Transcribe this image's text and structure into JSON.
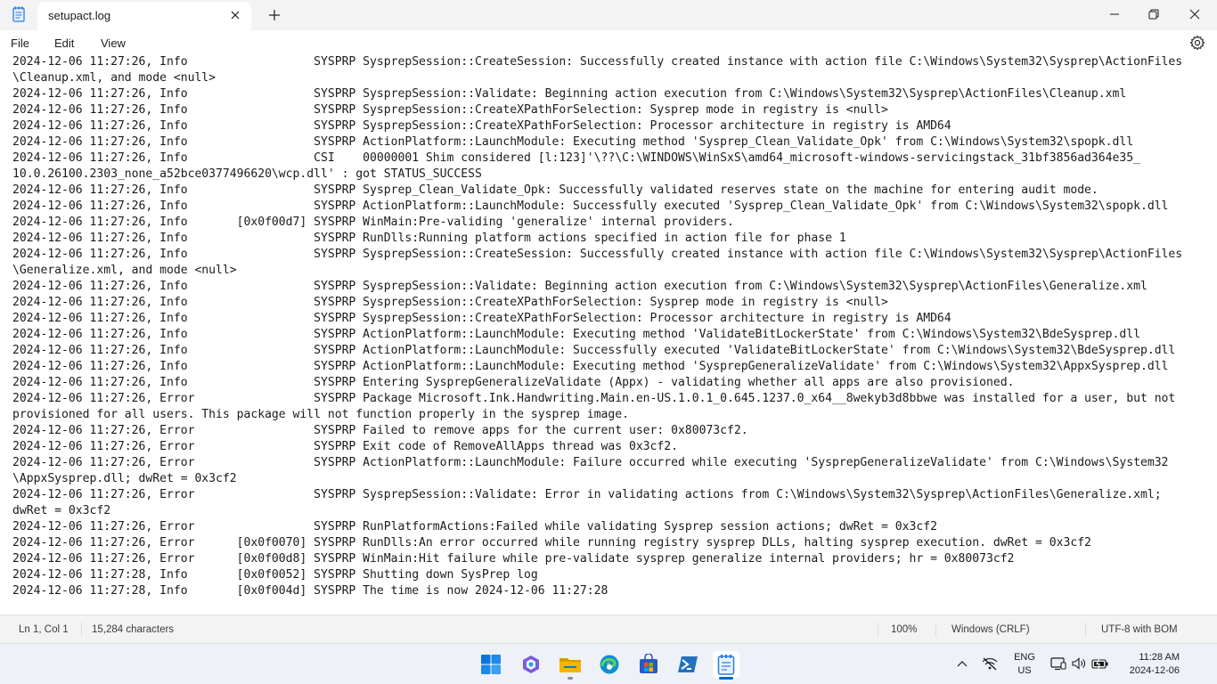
{
  "window": {
    "tab_title": "setupact.log",
    "new_tab_symbol": "+",
    "controls": [
      "minimize-icon",
      "maximize-icon",
      "close-icon"
    ]
  },
  "menu": {
    "file": "File",
    "edit": "Edit",
    "view": "View",
    "settings_icon": "gear-icon"
  },
  "editor": {
    "content": "2024-12-06 11:27:26, Info                  SYSPRP SysprepSession::CreateSession: Successfully created instance with action file C:\\Windows\\System32\\Sysprep\\ActionFiles\n\\Cleanup.xml, and mode <null>\n2024-12-06 11:27:26, Info                  SYSPRP SysprepSession::Validate: Beginning action execution from C:\\Windows\\System32\\Sysprep\\ActionFiles\\Cleanup.xml\n2024-12-06 11:27:26, Info                  SYSPRP SysprepSession::CreateXPathForSelection: Sysprep mode in registry is <null>\n2024-12-06 11:27:26, Info                  SYSPRP SysprepSession::CreateXPathForSelection: Processor architecture in registry is AMD64\n2024-12-06 11:27:26, Info                  SYSPRP ActionPlatform::LaunchModule: Executing method 'Sysprep_Clean_Validate_Opk' from C:\\Windows\\System32\\spopk.dll\n2024-12-06 11:27:26, Info                  CSI    00000001 Shim considered [l:123]'\\??\\C:\\WINDOWS\\WinSxS\\amd64_microsoft-windows-servicingstack_31bf3856ad364e35_\n10.0.26100.2303_none_a52bce0377496620\\wcp.dll' : got STATUS_SUCCESS\n2024-12-06 11:27:26, Info                  SYSPRP Sysprep_Clean_Validate_Opk: Successfully validated reserves state on the machine for entering audit mode.\n2024-12-06 11:27:26, Info                  SYSPRP ActionPlatform::LaunchModule: Successfully executed 'Sysprep_Clean_Validate_Opk' from C:\\Windows\\System32\\spopk.dll\n2024-12-06 11:27:26, Info       [0x0f00d7] SYSPRP WinMain:Pre-validing 'generalize' internal providers.\n2024-12-06 11:27:26, Info                  SYSPRP RunDlls:Running platform actions specified in action file for phase 1\n2024-12-06 11:27:26, Info                  SYSPRP SysprepSession::CreateSession: Successfully created instance with action file C:\\Windows\\System32\\Sysprep\\ActionFiles\n\\Generalize.xml, and mode <null>\n2024-12-06 11:27:26, Info                  SYSPRP SysprepSession::Validate: Beginning action execution from C:\\Windows\\System32\\Sysprep\\ActionFiles\\Generalize.xml\n2024-12-06 11:27:26, Info                  SYSPRP SysprepSession::CreateXPathForSelection: Sysprep mode in registry is <null>\n2024-12-06 11:27:26, Info                  SYSPRP SysprepSession::CreateXPathForSelection: Processor architecture in registry is AMD64\n2024-12-06 11:27:26, Info                  SYSPRP ActionPlatform::LaunchModule: Executing method 'ValidateBitLockerState' from C:\\Windows\\System32\\BdeSysprep.dll\n2024-12-06 11:27:26, Info                  SYSPRP ActionPlatform::LaunchModule: Successfully executed 'ValidateBitLockerState' from C:\\Windows\\System32\\BdeSysprep.dll\n2024-12-06 11:27:26, Info                  SYSPRP ActionPlatform::LaunchModule: Executing method 'SysprepGeneralizeValidate' from C:\\Windows\\System32\\AppxSysprep.dll\n2024-12-06 11:27:26, Info                  SYSPRP Entering SysprepGeneralizeValidate (Appx) - validating whether all apps are also provisioned.\n2024-12-06 11:27:26, Error                 SYSPRP Package Microsoft.Ink.Handwriting.Main.en-US.1.0.1_0.645.1237.0_x64__8wekyb3d8bbwe was installed for a user, but not\nprovisioned for all users. This package will not function properly in the sysprep image.\n2024-12-06 11:27:26, Error                 SYSPRP Failed to remove apps for the current user: 0x80073cf2.\n2024-12-06 11:27:26, Error                 SYSPRP Exit code of RemoveAllApps thread was 0x3cf2.\n2024-12-06 11:27:26, Error                 SYSPRP ActionPlatform::LaunchModule: Failure occurred while executing 'SysprepGeneralizeValidate' from C:\\Windows\\System32\n\\AppxSysprep.dll; dwRet = 0x3cf2\n2024-12-06 11:27:26, Error                 SYSPRP SysprepSession::Validate: Error in validating actions from C:\\Windows\\System32\\Sysprep\\ActionFiles\\Generalize.xml;\ndwRet = 0x3cf2\n2024-12-06 11:27:26, Error                 SYSPRP RunPlatformActions:Failed while validating Sysprep session actions; dwRet = 0x3cf2\n2024-12-06 11:27:26, Error      [0x0f0070] SYSPRP RunDlls:An error occurred while running registry sysprep DLLs, halting sysprep execution. dwRet = 0x3cf2\n2024-12-06 11:27:26, Error      [0x0f00d8] SYSPRP WinMain:Hit failure while pre-validate sysprep generalize internal providers; hr = 0x80073cf2\n2024-12-06 11:27:28, Info       [0x0f0052] SYSPRP Shutting down SysPrep log\n2024-12-06 11:27:28, Info       [0x0f004d] SYSPRP The time is now 2024-12-06 11:27:28"
  },
  "status": {
    "position": "Ln 1, Col 1",
    "characters": "15,284 characters",
    "zoom": "100%",
    "line_ending": "Windows (CRLF)",
    "encoding": "UTF-8 with BOM"
  },
  "taskbar": {
    "apps": [
      "windows-start-icon",
      "copilot-icon",
      "file-explorer-icon",
      "edge-browser-icon",
      "microsoft-store-icon",
      "powershell-icon",
      "notepad-icon"
    ],
    "active_app": "notepad-icon",
    "language_line1": "ENG",
    "language_line2": "US",
    "time": "11:28 AM",
    "date": "2024-12-06",
    "colors": {
      "start": "#0a74d9",
      "explorer": "#f4b400",
      "edge": "#0f8fd4",
      "store": "#2b59c3",
      "powershell": "#2671be",
      "notepad": "#2a7de1",
      "indicator": "#0067c0"
    }
  }
}
